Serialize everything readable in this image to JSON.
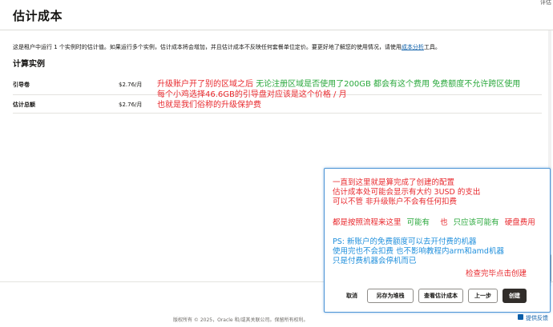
{
  "page": {
    "title": "估计成本",
    "top_help": "评估",
    "description_before_link": "这是租户中运行 1 个实例时的估计值。如果运行多个实例，估计成本将会增加，并且估计成本不反映任何套餐单位定价。要更好地了解您的使用情况，请使用",
    "description_link": "成本分析",
    "description_after_link": "工具。"
  },
  "section": {
    "title": "计算实例"
  },
  "rows": [
    {
      "label": "引导卷",
      "price": "$2.76/月"
    },
    {
      "label": "估计总额",
      "price": "$2.76/月"
    }
  ],
  "annotations": {
    "line1_red": "升级账户开了别的区域之后",
    "line1_green": "无论注册区域是否使用了200GB 都会有这个费用 免费额度不允许跨区使用",
    "line2_red": "每个小鸡选择46.6GB的引导盘对应该是这个价格 / 月",
    "line3_red": "也就是我们俗称的升级保护费"
  },
  "overlay": {
    "line1": "一直到这里就是算完成了创建的配置",
    "line2": "估计成本处可能会显示有大约 3USD  的支出",
    "line3": "可以不管  非升级账户不会有任何扣费",
    "line4_a": "都是按照流程来这里",
    "line4_b": "可能有",
    "line4_c": "也",
    "line4_d": "只应该可能有",
    "line4_e": "硬盘费用",
    "line5": "PS: 新账户的免费额度可以去开付费的机器",
    "line6": "使用完也不会扣费 也不影响教程内arm和amd机器",
    "line7": "只是付费机器会停机而已",
    "line8": "检查完毕点击创建"
  },
  "buttons": {
    "cancel": "取消",
    "save_stack": "另存为堆栈",
    "view_cost": "查看估计成本",
    "previous": "上一步",
    "create": "创建"
  },
  "footer": {
    "copyright": "版权所有 © 2025，Oracle 和/或其关联公司。保留所有权利。",
    "feedback": "提供反馈"
  },
  "colors": {
    "annotation_red": "#e8282d",
    "annotation_green": "#2aa83c",
    "annotation_blue": "#1f8fdc",
    "primary_button": "#312d2a",
    "link": "#0b5ea8"
  }
}
